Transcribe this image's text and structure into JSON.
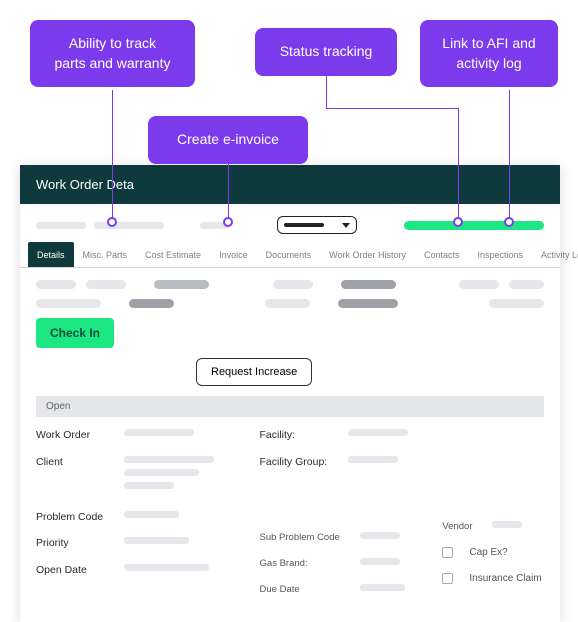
{
  "callouts": {
    "parts": "Ability to track parts and warranty",
    "einvoice": "Create e-invoice",
    "status": "Status tracking",
    "afi": "Link to AFI and activity log"
  },
  "titlebar": "Work Order Deta",
  "tabs": {
    "details": "Details",
    "misc": "Misc. Parts",
    "cost": "Cost Estimate",
    "invoice": "Invoice",
    "docs": "Documents",
    "history": "Work Order History",
    "contacts": "Contacts",
    "inspections": "Inspections",
    "activity": "Activity Log"
  },
  "buttons": {
    "check_in": "Check In",
    "request_increase": "Request Increase"
  },
  "open_label": "Open",
  "fields": {
    "work_order": "Work Order",
    "client": "Client",
    "problem_code": "Problem Code",
    "priority": "Priority",
    "open_date": "Open Date",
    "facility": "Facility:",
    "facility_group": "Facility Group:",
    "sub_problem": "Sub Problem Code",
    "gas_brand": "Gas Brand:",
    "due_date": "Due Date",
    "vendor": "Vendor",
    "cap_ex": "Cap Ex?",
    "insurance": "Insurance Claim"
  }
}
